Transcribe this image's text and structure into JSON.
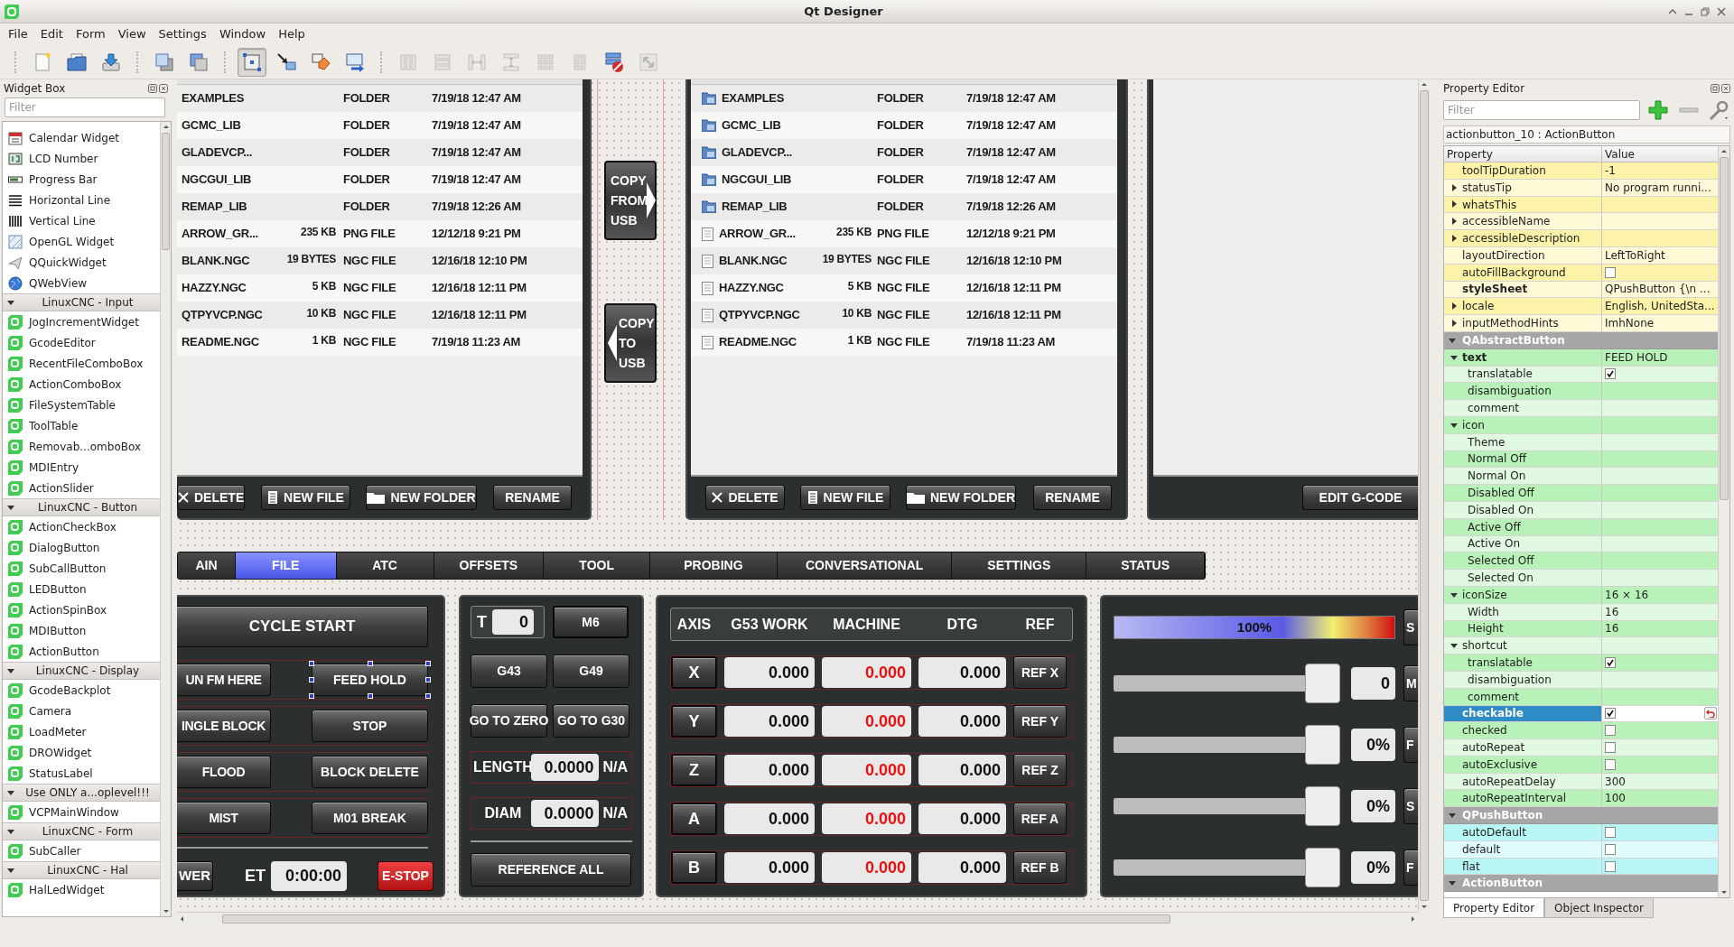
{
  "window": {
    "title": "Qt Designer"
  },
  "menu": [
    "File",
    "Edit",
    "Form",
    "View",
    "Settings",
    "Window",
    "Help"
  ],
  "toolbar": [
    {
      "selected": false,
      "disabled": false
    },
    {
      "selected": false,
      "disabled": false
    },
    {
      "selected": false,
      "disabled": false
    },
    {
      "selected": false,
      "disabled": false
    },
    {
      "selected": false,
      "disabled": false
    },
    {
      "selected": true,
      "disabled": false
    },
    {
      "selected": false,
      "disabled": false
    },
    {
      "selected": false,
      "disabled": false
    },
    {
      "selected": false,
      "disabled": false
    },
    {
      "selected": false,
      "disabled": true
    },
    {
      "selected": false,
      "disabled": true
    },
    {
      "selected": false,
      "disabled": true
    },
    {
      "selected": false,
      "disabled": true
    },
    {
      "selected": false,
      "disabled": true
    },
    {
      "selected": false,
      "disabled": true
    },
    {
      "selected": false,
      "disabled": false
    },
    {
      "selected": false,
      "disabled": true
    }
  ],
  "widget_box": {
    "title": "Widget Box",
    "filter_placeholder": "Filter",
    "sections": [
      {
        "items": [
          "Calendar Widget",
          "LCD Number",
          "Progress Bar",
          "Horizontal Line",
          "Vertical Line",
          "OpenGL Widget",
          "QQuickWidget",
          "QWebView"
        ]
      },
      {
        "label": "LinuxCNC - Input",
        "expanded": true,
        "items": [
          "JogIncrementWidget",
          "GcodeEditor",
          "RecentFileComboBox",
          "ActionComboBox",
          "FileSystemTable",
          "ToolTable",
          "Removab...omboBox",
          "MDIEntry",
          "ActionSlider"
        ]
      },
      {
        "label": "LinuxCNC - Button",
        "expanded": true,
        "items": [
          "ActionCheckBox",
          "DialogButton",
          "SubCallButton",
          "LEDButton",
          "ActionSpinBox",
          "MDIButton",
          "ActionButton"
        ]
      },
      {
        "label": "LinuxCNC - Display",
        "expanded": true,
        "items": [
          "GcodeBackplot",
          "Camera",
          "LoadMeter",
          "DROWidget",
          "StatusLabel"
        ]
      },
      {
        "label": "Use ONLY a...oplevel!!!",
        "expanded": true,
        "items": [
          "VCPMainWindow"
        ]
      },
      {
        "label": "LinuxCNC - Form",
        "expanded": true,
        "items": [
          "SubCaller"
        ]
      },
      {
        "label": "LinuxCNC - Hal",
        "expanded": true,
        "items": [
          "HalLedWidget"
        ]
      }
    ]
  },
  "form": {
    "file_panels": [
      {
        "icons": false,
        "rows": [
          {
            "name": "EXAMPLES",
            "type": "FOLDER",
            "date": "7/19/18 12:47 AM"
          },
          {
            "name": "GCMC_LIB",
            "type": "FOLDER",
            "date": "7/19/18 12:47 AM"
          },
          {
            "name": "GLADEVCP...",
            "type": "FOLDER",
            "date": "7/19/18 12:47 AM"
          },
          {
            "name": "NGCGUI_LIB",
            "type": "FOLDER",
            "date": "7/19/18 12:47 AM"
          },
          {
            "name": "REMAP_LIB",
            "type": "FOLDER",
            "date": "7/19/18 12:26 AM"
          },
          {
            "name": "ARROW_GR...",
            "size": "235 KB",
            "type": "PNG FILE",
            "date": "12/12/18 9:21 PM"
          },
          {
            "name": "BLANK.NGC",
            "size": "19 BYTES",
            "type": "NGC FILE",
            "date": "12/16/18 12:10 PM"
          },
          {
            "name": "HAZZY.NGC",
            "size": "5 KB",
            "type": "NGC FILE",
            "date": "12/16/18 12:11 PM"
          },
          {
            "name": "QTPYVCP.NGC",
            "size": "10 KB",
            "type": "NGC FILE",
            "date": "12/16/18 12:11 PM"
          },
          {
            "name": "README.NGC",
            "size": "1 KB",
            "type": "NGC FILE",
            "date": "7/19/18 11:23 AM"
          }
        ],
        "buttons": [
          {
            "kind": "delete",
            "label": "DELETE"
          },
          {
            "kind": "new-file",
            "label": "NEW FILE"
          },
          {
            "kind": "new-folder",
            "label": "NEW FOLDER"
          },
          {
            "kind": "rename",
            "label": "RENAME"
          }
        ]
      },
      {
        "icons": true,
        "rows": [
          {
            "kind": "folder",
            "name": "EXAMPLES",
            "type": "FOLDER",
            "date": "7/19/18 12:47 AM"
          },
          {
            "kind": "folder",
            "name": "GCMC_LIB",
            "type": "FOLDER",
            "date": "7/19/18 12:47 AM"
          },
          {
            "kind": "folder",
            "name": "GLADEVCP...",
            "type": "FOLDER",
            "date": "7/19/18 12:47 AM"
          },
          {
            "kind": "folder",
            "name": "NGCGUI_LIB",
            "type": "FOLDER",
            "date": "7/19/18 12:47 AM"
          },
          {
            "kind": "folder",
            "name": "REMAP_LIB",
            "type": "FOLDER",
            "date": "7/19/18 12:26 AM"
          },
          {
            "kind": "file",
            "name": "ARROW_GR...",
            "size": "235 KB",
            "type": "PNG FILE",
            "date": "12/12/18 9:21 PM"
          },
          {
            "kind": "file",
            "name": "BLANK.NGC",
            "size": "19 BYTES",
            "type": "NGC FILE",
            "date": "12/16/18 12:10 PM"
          },
          {
            "kind": "file",
            "name": "HAZZY.NGC",
            "size": "5 KB",
            "type": "NGC FILE",
            "date": "12/16/18 12:11 PM"
          },
          {
            "kind": "file",
            "name": "QTPYVCP.NGC",
            "size": "10 KB",
            "type": "NGC FILE",
            "date": "12/16/18 12:11 PM"
          },
          {
            "kind": "file",
            "name": "README.NGC",
            "size": "1 KB",
            "type": "NGC FILE",
            "date": "7/19/18 11:23 AM"
          }
        ],
        "buttons": [
          {
            "kind": "delete",
            "label": "DELETE"
          },
          {
            "kind": "new-file",
            "label": "NEW FILE"
          },
          {
            "kind": "new-folder",
            "label": "NEW FOLDER"
          },
          {
            "kind": "rename",
            "label": "RENAME"
          }
        ]
      }
    ],
    "copy_buttons": [
      {
        "label": "COPY FROM USB",
        "kind": "copy-from"
      },
      {
        "label": "COPY TO USB",
        "kind": "copy-to"
      }
    ],
    "editor_button": "EDIT G-CODE",
    "tabs": [
      {
        "label": "AIN",
        "selected": false
      },
      {
        "label": "FILE",
        "selected": true
      },
      {
        "label": "ATC",
        "selected": false
      },
      {
        "label": "OFFSETS",
        "selected": false
      },
      {
        "label": "TOOL",
        "selected": false
      },
      {
        "label": "PROBING",
        "selected": false
      },
      {
        "label": "CONVERSATIONAL",
        "selected": false
      },
      {
        "label": "SETTINGS",
        "selected": false
      },
      {
        "label": "STATUS",
        "selected": false
      }
    ],
    "program": {
      "cycle_start": "CYCLE START",
      "rows": [
        [
          {
            "label": "UN FM HERE",
            "selected": false
          },
          {
            "label": "FEED HOLD",
            "selected": true
          }
        ],
        [
          {
            "label": "INGLE BLOCK",
            "selected": false
          },
          {
            "label": "STOP",
            "selected": false
          }
        ],
        [
          {
            "label": "FLOOD",
            "selected": false
          },
          {
            "label": "BLOCK DELETE",
            "selected": false
          }
        ],
        [
          {
            "label": "MIST",
            "selected": false
          },
          {
            "label": "M01 BREAK",
            "selected": false
          }
        ]
      ],
      "bottom": [
        {
          "kind": "button",
          "label": "WER"
        },
        {
          "kind": "label",
          "label": "ET"
        },
        {
          "kind": "field",
          "value": "0:00:00"
        },
        {
          "kind": "estop",
          "label": "E-STOP"
        }
      ]
    },
    "tool": {
      "label": "T",
      "value": "0",
      "change": "M6",
      "rows": [
        [
          "G43",
          "G49"
        ],
        [
          "GO TO ZERO",
          "GO TO G30"
        ]
      ],
      "offsets": [
        {
          "label": "LENGTH",
          "value": "0.0000",
          "unit": "N/A"
        },
        {
          "label": "DIAM",
          "value": "0.0000",
          "unit": "N/A"
        }
      ],
      "reference_all": "REFERENCE ALL"
    },
    "dro": {
      "columns": [
        "AXIS",
        "G53 WORK",
        "MACHINE",
        "DTG",
        "REF"
      ],
      "axes": [
        {
          "axis": "X",
          "work": "0.000",
          "machine": "0.000",
          "dtg": "0.000",
          "ref": "REF X"
        },
        {
          "axis": "Y",
          "work": "0.000",
          "machine": "0.000",
          "dtg": "0.000",
          "ref": "REF Y"
        },
        {
          "axis": "Z",
          "work": "0.000",
          "machine": "0.000",
          "dtg": "0.000",
          "ref": "REF Z"
        },
        {
          "axis": "A",
          "work": "0.000",
          "machine": "0.000",
          "dtg": "0.000",
          "ref": "REF A"
        },
        {
          "axis": "B",
          "work": "0.000",
          "machine": "0.000",
          "dtg": "0.000",
          "ref": "REF B"
        }
      ]
    },
    "overrides": {
      "meter": {
        "label": "100%",
        "side": "S"
      },
      "sliders": [
        {
          "level": 1,
          "value": "0",
          "side": "M"
        },
        {
          "level": 1,
          "value": "0%",
          "side": "F"
        },
        {
          "level": 1,
          "value": "0%",
          "side": "S"
        },
        {
          "level": 1,
          "value": "0%",
          "side": "F"
        }
      ]
    }
  },
  "property_editor": {
    "title": "Property Editor",
    "filter_placeholder": "Filter",
    "object": "actionbutton_10 : ActionButton",
    "columns": [
      "Property",
      "Value"
    ],
    "groups": [
      {
        "color": "#fcf3a8",
        "properties": [
          {
            "name": "toolTipDuration",
            "kind": "text",
            "value": "-1",
            "modified": false,
            "selected": false
          },
          {
            "name": "statusTip",
            "kind": "text",
            "value": "No program runni...",
            "expanded": false,
            "modified": false,
            "selected": false
          },
          {
            "name": "whatsThis",
            "kind": "text",
            "expanded": false,
            "modified": false,
            "selected": false
          },
          {
            "name": "accessibleName",
            "kind": "text",
            "expanded": false,
            "modified": false,
            "selected": false
          },
          {
            "name": "accessibleDescription",
            "kind": "text",
            "expanded": false,
            "modified": false,
            "selected": false
          },
          {
            "name": "layoutDirection",
            "kind": "text",
            "value": "LeftToRight",
            "modified": false,
            "selected": false
          },
          {
            "name": "autoFillBackground",
            "kind": "checkbox",
            "checked": false,
            "modified": false,
            "selected": false
          },
          {
            "name": "styleSheet",
            "kind": "text",
            "value": "QPushButton {\\n  ...",
            "modified": true,
            "selected": false
          },
          {
            "name": "locale",
            "kind": "text",
            "value": "English, UnitedSta...",
            "expanded": false,
            "modified": false,
            "selected": false
          },
          {
            "name": "inputMethodHints",
            "kind": "text",
            "value": "ImhNone",
            "expanded": false,
            "modified": false,
            "selected": false
          }
        ]
      },
      {
        "label": "QAbstractButton",
        "expanded": true,
        "color": "#b9f2b9",
        "properties": [
          {
            "name": "text",
            "kind": "text",
            "value": "FEED HOLD",
            "expanded": true,
            "modified": true,
            "selected": false,
            "children": [
              {
                "name": "translatable",
                "kind": "checkbox",
                "checked": true,
                "modified": false,
                "selected": false
              },
              {
                "name": "disambiguation",
                "kind": "text",
                "modified": false,
                "selected": false
              },
              {
                "name": "comment",
                "kind": "text",
                "modified": false,
                "selected": false
              }
            ]
          },
          {
            "name": "icon",
            "kind": "text",
            "expanded": true,
            "modified": false,
            "selected": false,
            "children": [
              {
                "name": "Theme",
                "kind": "text",
                "modified": false,
                "selected": false
              },
              {
                "name": "Normal Off",
                "kind": "text",
                "modified": false,
                "selected": false
              },
              {
                "name": "Normal On",
                "kind": "text",
                "modified": false,
                "selected": false
              },
              {
                "name": "Disabled Off",
                "kind": "text",
                "modified": false,
                "selected": false
              },
              {
                "name": "Disabled On",
                "kind": "text",
                "modified": false,
                "selected": false
              },
              {
                "name": "Active Off",
                "kind": "text",
                "modified": false,
                "selected": false
              },
              {
                "name": "Active On",
                "kind": "text",
                "modified": false,
                "selected": false
              },
              {
                "name": "Selected Off",
                "kind": "text",
                "modified": false,
                "selected": false
              },
              {
                "name": "Selected On",
                "kind": "text",
                "modified": false,
                "selected": false
              }
            ]
          },
          {
            "name": "iconSize",
            "kind": "text",
            "value": "16 × 16",
            "expanded": true,
            "modified": false,
            "selected": false,
            "children": [
              {
                "name": "Width",
                "kind": "text",
                "value": "16",
                "modified": false,
                "selected": false
              },
              {
                "name": "Height",
                "kind": "text",
                "value": "16",
                "modified": false,
                "selected": false
              }
            ]
          },
          {
            "name": "shortcut",
            "kind": "text",
            "expanded": true,
            "modified": false,
            "selected": false,
            "children": [
              {
                "name": "translatable",
                "kind": "checkbox",
                "checked": true,
                "modified": false,
                "selected": false
              },
              {
                "name": "disambiguation",
                "kind": "text",
                "modified": false,
                "selected": false
              },
              {
                "name": "comment",
                "kind": "text",
                "modified": false,
                "selected": false
              }
            ]
          },
          {
            "name": "checkable",
            "kind": "checkbox",
            "checked": true,
            "modified": true,
            "selected": true
          },
          {
            "name": "checked",
            "kind": "checkbox",
            "checked": false,
            "modified": false,
            "selected": false
          },
          {
            "name": "autoRepeat",
            "kind": "checkbox",
            "checked": false,
            "modified": false,
            "selected": false
          },
          {
            "name": "autoExclusive",
            "kind": "checkbox",
            "checked": false,
            "modified": false,
            "selected": false
          },
          {
            "name": "autoRepeatDelay",
            "kind": "text",
            "value": "300",
            "modified": false,
            "selected": false
          },
          {
            "name": "autoRepeatInterval",
            "kind": "text",
            "value": "100",
            "modified": false,
            "selected": false
          }
        ]
      },
      {
        "label": "QPushButton",
        "expanded": true,
        "color": "#b8f6f6",
        "properties": [
          {
            "name": "autoDefault",
            "kind": "checkbox",
            "checked": false,
            "modified": false,
            "selected": false
          },
          {
            "name": "default",
            "kind": "checkbox",
            "checked": false,
            "modified": false,
            "selected": false
          },
          {
            "name": "flat",
            "kind": "checkbox",
            "checked": false,
            "modified": false,
            "selected": false
          }
        ]
      },
      {
        "label": "ActionButton",
        "expanded": true
      }
    ],
    "tabs": [
      {
        "label": "Property Editor",
        "selected": true
      },
      {
        "label": "Object Inspector",
        "selected": false
      }
    ]
  }
}
